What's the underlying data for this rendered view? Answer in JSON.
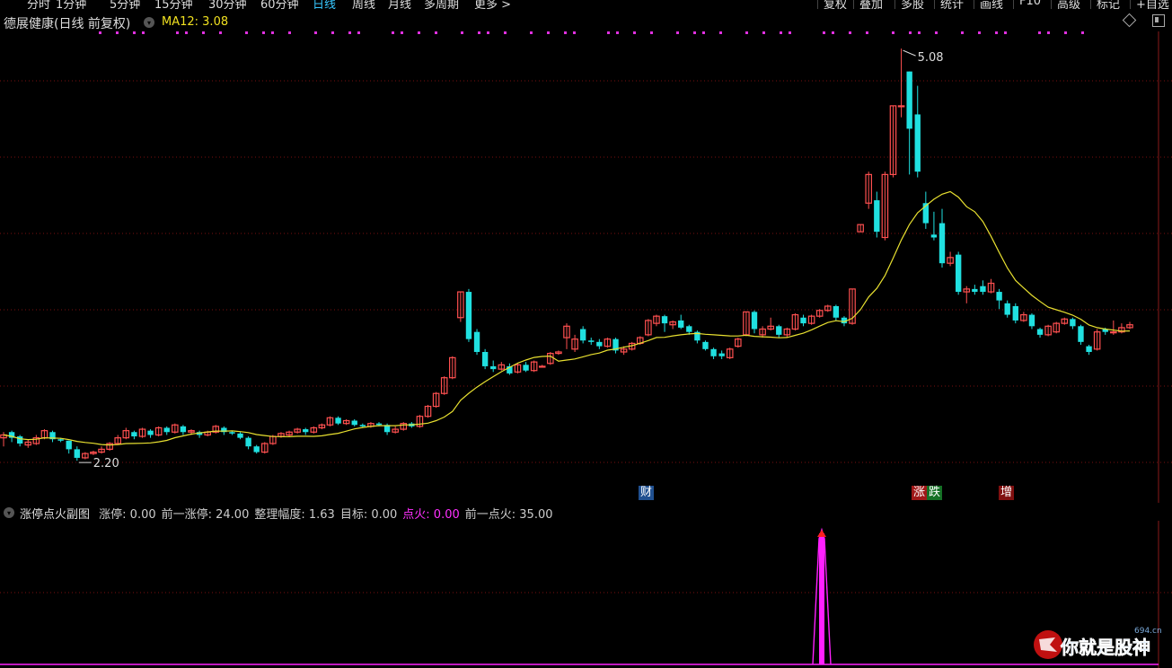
{
  "toolbar": {
    "periods": [
      "分时",
      "1分钟",
      "5分钟",
      "15分钟",
      "30分钟",
      "60分钟",
      "日线",
      "周线",
      "月线",
      "多周期",
      "更多 >"
    ],
    "active_period": "日线",
    "buttons": [
      "复权",
      "叠加",
      "多股",
      "统计",
      "画线",
      "F10",
      "高级",
      "标记",
      "+自选"
    ]
  },
  "main": {
    "title": "德展健康(日线 前复权)",
    "ma_label": "MA12: 3.08",
    "high_label": "5.08",
    "low_label": "2.20",
    "tags": {
      "cai": "财",
      "zhang": "涨",
      "die": "跌",
      "zeng": "增"
    }
  },
  "sub": {
    "name": "涨停点火副图",
    "items": [
      {
        "label": "涨停: 0.00",
        "color": "#cccccc"
      },
      {
        "label": "前一涨停: 24.00",
        "color": "#cccccc"
      },
      {
        "label": "整理幅度: 1.63",
        "color": "#cccccc"
      },
      {
        "label": "目标: 0.00",
        "color": "#cccccc"
      },
      {
        "label": "点火: 0.00",
        "color": "#ff30ff"
      },
      {
        "label": "前一点火: 35.00",
        "color": "#cccccc"
      }
    ]
  },
  "watermark": {
    "text": "你就是股神",
    "site": "694.cn"
  },
  "colors": {
    "up": "#ff5050",
    "down": "#20e0e0",
    "ma": "#e8e030",
    "signal": "#ff20ff",
    "grid": "#7a1010"
  },
  "chart_data": {
    "type": "candlestick",
    "ylim": [
      2.0,
      5.2
    ],
    "high_value": 5.08,
    "low_value": 2.2,
    "ma_period": 12,
    "ma_last": 3.08,
    "candles": [
      [
        2.36,
        2.38,
        2.3,
        2.4
      ],
      [
        2.4,
        2.36,
        2.33,
        2.41
      ],
      [
        2.37,
        2.32,
        2.3,
        2.38
      ],
      [
        2.31,
        2.33,
        2.29,
        2.35
      ],
      [
        2.32,
        2.36,
        2.31,
        2.38
      ],
      [
        2.36,
        2.41,
        2.35,
        2.42
      ],
      [
        2.4,
        2.35,
        2.33,
        2.41
      ],
      [
        2.35,
        2.34,
        2.33,
        2.36
      ],
      [
        2.34,
        2.28,
        2.25,
        2.34
      ],
      [
        2.28,
        2.22,
        2.2,
        2.3
      ],
      [
        2.22,
        2.25,
        2.21,
        2.26
      ],
      [
        2.25,
        2.26,
        2.24,
        2.27
      ],
      [
        2.26,
        2.28,
        2.25,
        2.3
      ],
      [
        2.28,
        2.32,
        2.27,
        2.33
      ],
      [
        2.32,
        2.36,
        2.31,
        2.38
      ],
      [
        2.36,
        2.41,
        2.35,
        2.43
      ],
      [
        2.4,
        2.37,
        2.35,
        2.41
      ],
      [
        2.37,
        2.42,
        2.36,
        2.43
      ],
      [
        2.41,
        2.38,
        2.36,
        2.42
      ],
      [
        2.38,
        2.43,
        2.37,
        2.44
      ],
      [
        2.43,
        2.4,
        2.38,
        2.44
      ],
      [
        2.4,
        2.45,
        2.39,
        2.46
      ],
      [
        2.44,
        2.4,
        2.38,
        2.45
      ],
      [
        2.4,
        2.41,
        2.38,
        2.42
      ],
      [
        2.4,
        2.38,
        2.36,
        2.41
      ],
      [
        2.38,
        2.4,
        2.37,
        2.41
      ],
      [
        2.4,
        2.44,
        2.39,
        2.45
      ],
      [
        2.43,
        2.4,
        2.38,
        2.44
      ],
      [
        2.4,
        2.39,
        2.38,
        2.41
      ],
      [
        2.39,
        2.36,
        2.35,
        2.4
      ],
      [
        2.36,
        2.3,
        2.28,
        2.37
      ],
      [
        2.3,
        2.26,
        2.25,
        2.31
      ],
      [
        2.26,
        2.32,
        2.25,
        2.33
      ],
      [
        2.32,
        2.37,
        2.31,
        2.38
      ],
      [
        2.37,
        2.39,
        2.36,
        2.4
      ],
      [
        2.38,
        2.4,
        2.37,
        2.41
      ],
      [
        2.4,
        2.42,
        2.39,
        2.43
      ],
      [
        2.42,
        2.4,
        2.38,
        2.43
      ],
      [
        2.4,
        2.43,
        2.39,
        2.44
      ],
      [
        2.43,
        2.45,
        2.42,
        2.46
      ],
      [
        2.45,
        2.5,
        2.44,
        2.51
      ],
      [
        2.5,
        2.46,
        2.45,
        2.51
      ],
      [
        2.46,
        2.48,
        2.45,
        2.49
      ],
      [
        2.48,
        2.45,
        2.44,
        2.49
      ],
      [
        2.45,
        2.44,
        2.43,
        2.46
      ],
      [
        2.44,
        2.46,
        2.43,
        2.47
      ],
      [
        2.46,
        2.45,
        2.44,
        2.47
      ],
      [
        2.45,
        2.4,
        2.38,
        2.46
      ],
      [
        2.4,
        2.42,
        2.39,
        2.44
      ],
      [
        2.42,
        2.46,
        2.41,
        2.47
      ],
      [
        2.46,
        2.44,
        2.43,
        2.47
      ],
      [
        2.44,
        2.51,
        2.43,
        2.52
      ],
      [
        2.51,
        2.58,
        2.5,
        2.59
      ],
      [
        2.58,
        2.67,
        2.57,
        2.68
      ],
      [
        2.67,
        2.78,
        2.66,
        2.79
      ],
      [
        2.78,
        2.92,
        2.77,
        2.93
      ],
      [
        3.2,
        3.38,
        3.17,
        3.38
      ],
      [
        3.38,
        3.05,
        3.03,
        3.4
      ],
      [
        3.1,
        2.96,
        2.94,
        3.12
      ],
      [
        2.96,
        2.86,
        2.84,
        2.98
      ],
      [
        2.86,
        2.84,
        2.82,
        2.9
      ],
      [
        2.84,
        2.87,
        2.83,
        2.89
      ],
      [
        2.86,
        2.81,
        2.8,
        2.88
      ],
      [
        2.82,
        2.87,
        2.81,
        2.88
      ],
      [
        2.87,
        2.83,
        2.82,
        2.89
      ],
      [
        2.83,
        2.89,
        2.82,
        2.9
      ],
      [
        2.86,
        2.86,
        2.85,
        2.87
      ],
      [
        2.88,
        2.95,
        2.87,
        2.96
      ],
      [
        2.95,
        2.96,
        2.94,
        2.97
      ],
      [
        3.06,
        3.14,
        2.98,
        3.16
      ],
      [
        2.98,
        3.05,
        2.96,
        3.08
      ],
      [
        3.12,
        3.04,
        3.02,
        3.14
      ],
      [
        3.04,
        3.03,
        3.01,
        3.06
      ],
      [
        3.03,
        3.0,
        2.98,
        3.05
      ],
      [
        3.0,
        3.05,
        2.99,
        3.06
      ],
      [
        3.05,
        2.97,
        2.95,
        3.06
      ],
      [
        2.96,
        2.98,
        2.94,
        3.0
      ],
      [
        2.98,
        3.02,
        2.97,
        3.03
      ],
      [
        3.02,
        3.06,
        3.01,
        3.07
      ],
      [
        3.08,
        3.18,
        3.07,
        3.19
      ],
      [
        3.16,
        3.21,
        3.14,
        3.22
      ],
      [
        3.21,
        3.16,
        3.1,
        3.22
      ],
      [
        3.15,
        3.17,
        3.12,
        3.18
      ],
      [
        3.18,
        3.13,
        3.12,
        3.22
      ],
      [
        3.14,
        3.1,
        3.08,
        3.15
      ],
      [
        3.1,
        3.04,
        3.02,
        3.11
      ],
      [
        3.03,
        2.98,
        2.97,
        3.04
      ],
      [
        2.98,
        2.93,
        2.91,
        2.99
      ],
      [
        2.95,
        2.93,
        2.91,
        2.97
      ],
      [
        2.92,
        2.98,
        2.91,
        2.99
      ],
      [
        3.0,
        3.05,
        2.99,
        3.06
      ],
      [
        3.08,
        3.24,
        3.07,
        3.24
      ],
      [
        3.24,
        3.12,
        3.09,
        3.25
      ],
      [
        3.08,
        3.12,
        3.06,
        3.14
      ],
      [
        3.12,
        3.14,
        3.11,
        3.2
      ],
      [
        3.14,
        3.08,
        3.06,
        3.15
      ],
      [
        3.08,
        3.12,
        3.06,
        3.13
      ],
      [
        3.12,
        3.22,
        3.11,
        3.23
      ],
      [
        3.2,
        3.16,
        3.14,
        3.22
      ],
      [
        3.16,
        3.21,
        3.15,
        3.22
      ],
      [
        3.21,
        3.25,
        3.2,
        3.26
      ],
      [
        3.25,
        3.28,
        3.24,
        3.29
      ],
      [
        3.28,
        3.2,
        3.18,
        3.29
      ],
      [
        3.2,
        3.16,
        3.14,
        3.21
      ],
      [
        3.16,
        3.4,
        3.15,
        3.4
      ],
      [
        3.8,
        3.85,
        3.8,
        3.85
      ],
      [
        4.0,
        4.2,
        3.96,
        4.22
      ],
      [
        4.02,
        3.8,
        3.76,
        4.08
      ],
      [
        3.76,
        4.2,
        3.74,
        4.22
      ],
      [
        4.2,
        4.68,
        4.18,
        4.68
      ],
      [
        4.68,
        4.68,
        4.6,
        5.08
      ],
      [
        4.92,
        4.52,
        4.2,
        4.92
      ],
      [
        4.62,
        4.22,
        4.18,
        4.82
      ],
      [
        4.0,
        3.86,
        3.82,
        4.08
      ],
      [
        3.78,
        3.76,
        3.74,
        3.94
      ],
      [
        3.86,
        3.58,
        3.55,
        3.96
      ],
      [
        3.58,
        3.62,
        3.56,
        3.66
      ],
      [
        3.64,
        3.38,
        3.36,
        3.66
      ],
      [
        3.38,
        3.4,
        3.3,
        3.42
      ],
      [
        3.4,
        3.38,
        3.36,
        3.43
      ],
      [
        3.42,
        3.38,
        3.36,
        3.46
      ],
      [
        3.38,
        3.44,
        3.37,
        3.47
      ],
      [
        3.38,
        3.32,
        3.26,
        3.4
      ],
      [
        3.3,
        3.22,
        3.2,
        3.32
      ],
      [
        3.28,
        3.18,
        3.16,
        3.3
      ],
      [
        3.18,
        3.22,
        3.17,
        3.24
      ],
      [
        3.22,
        3.14,
        3.12,
        3.23
      ],
      [
        3.12,
        3.08,
        3.06,
        3.13
      ],
      [
        3.08,
        3.14,
        3.07,
        3.15
      ],
      [
        3.1,
        3.16,
        3.09,
        3.17
      ],
      [
        3.16,
        3.19,
        3.15,
        3.2
      ],
      [
        3.19,
        3.14,
        3.12,
        3.2
      ],
      [
        3.14,
        3.03,
        3.01,
        3.15
      ],
      [
        3.0,
        2.96,
        2.94,
        3.01
      ],
      [
        2.98,
        3.1,
        2.97,
        3.12
      ],
      [
        3.12,
        3.1,
        3.08,
        3.13
      ],
      [
        3.1,
        3.1,
        3.08,
        3.18
      ],
      [
        3.1,
        3.13,
        3.09,
        3.16
      ],
      [
        3.13,
        3.15,
        3.12,
        3.17
      ]
    ],
    "indicator": {
      "name": "点火",
      "peak_value": 35.0
    }
  }
}
